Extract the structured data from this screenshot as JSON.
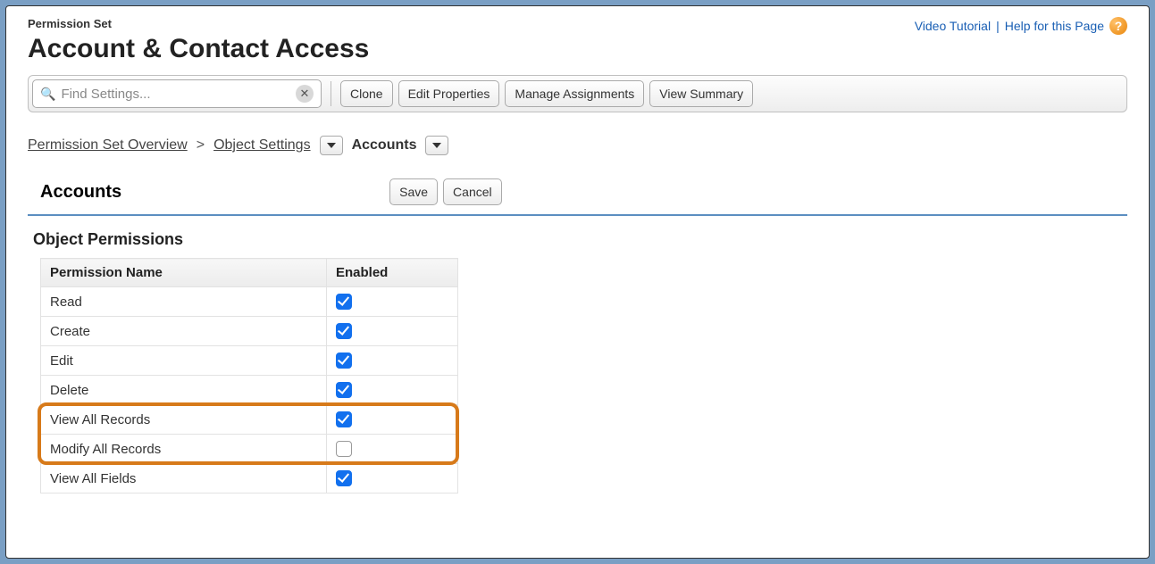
{
  "header": {
    "crumb": "Permission Set",
    "title": "Account & Contact Access",
    "help": {
      "tutorial": "Video Tutorial",
      "sep": "|",
      "help": "Help for this Page"
    }
  },
  "toolbar": {
    "search_placeholder": "Find Settings...",
    "buttons": {
      "clone": "Clone",
      "edit_props": "Edit Properties",
      "manage_assign": "Manage Assignments",
      "view_summary": "View Summary"
    }
  },
  "breadcrumb": {
    "overview": "Permission Set Overview",
    "object_settings": "Object Settings",
    "current": "Accounts"
  },
  "form": {
    "subtitle": "Accounts",
    "save": "Save",
    "cancel": "Cancel",
    "section": "Object Permissions",
    "columns": {
      "name": "Permission Name",
      "enabled": "Enabled"
    },
    "rows": [
      {
        "name": "Read",
        "enabled": true
      },
      {
        "name": "Create",
        "enabled": true
      },
      {
        "name": "Edit",
        "enabled": true
      },
      {
        "name": "Delete",
        "enabled": true
      },
      {
        "name": "View All Records",
        "enabled": true
      },
      {
        "name": "Modify All Records",
        "enabled": false
      },
      {
        "name": "View All Fields",
        "enabled": true
      }
    ],
    "highlight": {
      "from_row": 4,
      "to_row": 5
    }
  }
}
